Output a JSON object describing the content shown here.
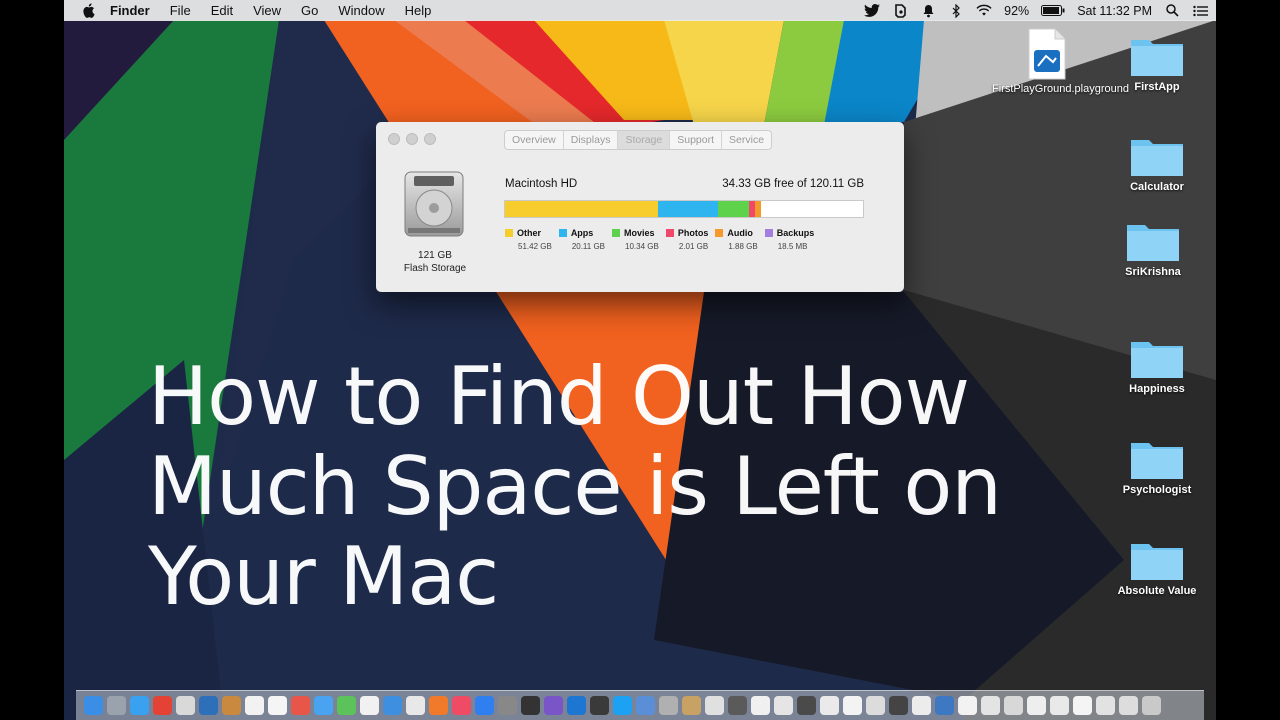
{
  "menubar": {
    "app": "Finder",
    "items": [
      "File",
      "Edit",
      "View",
      "Go",
      "Window",
      "Help"
    ],
    "status_icons": [
      "twitter-icon",
      "evernote-icon",
      "notification-icon",
      "bluetooth-icon",
      "wifi-icon"
    ],
    "battery": "92%",
    "clock": "Sat 11:32 PM"
  },
  "about_window": {
    "tabs": [
      "Overview",
      "Displays",
      "Storage",
      "Support",
      "Service"
    ],
    "active_tab": "Storage",
    "disk_capacity": "121 GB",
    "disk_type": "Flash Storage",
    "volume_name": "Macintosh HD",
    "free_space": "34.33 GB free of 120.11 GB",
    "storage": [
      {
        "name": "Other",
        "size": "51.42 GB",
        "gb": 51.42,
        "color": "#f7cd2e"
      },
      {
        "name": "Apps",
        "size": "20.11 GB",
        "gb": 20.11,
        "color": "#2eb4ee"
      },
      {
        "name": "Movies",
        "size": "10.34 GB",
        "gb": 10.34,
        "color": "#5ed24a"
      },
      {
        "name": "Photos",
        "size": "2.01 GB",
        "gb": 2.01,
        "color": "#f0476b"
      },
      {
        "name": "Audio",
        "size": "1.88 GB",
        "gb": 1.88,
        "color": "#f59a2a"
      },
      {
        "name": "Backups",
        "size": "18.5 MB",
        "gb": 0.0185,
        "color": "#a37ee0"
      }
    ],
    "total_gb": 120.11
  },
  "overlay_title": [
    "How to Find Out How",
    "Much Space is Left on",
    "Your Mac"
  ],
  "desktop": {
    "playground": {
      "label": "FirstPlayGround.playground"
    },
    "folders": [
      "FirstApp",
      "Calculator",
      "SriKrishna",
      "Happiness",
      "Psychologist",
      "Absolute Value"
    ]
  }
}
